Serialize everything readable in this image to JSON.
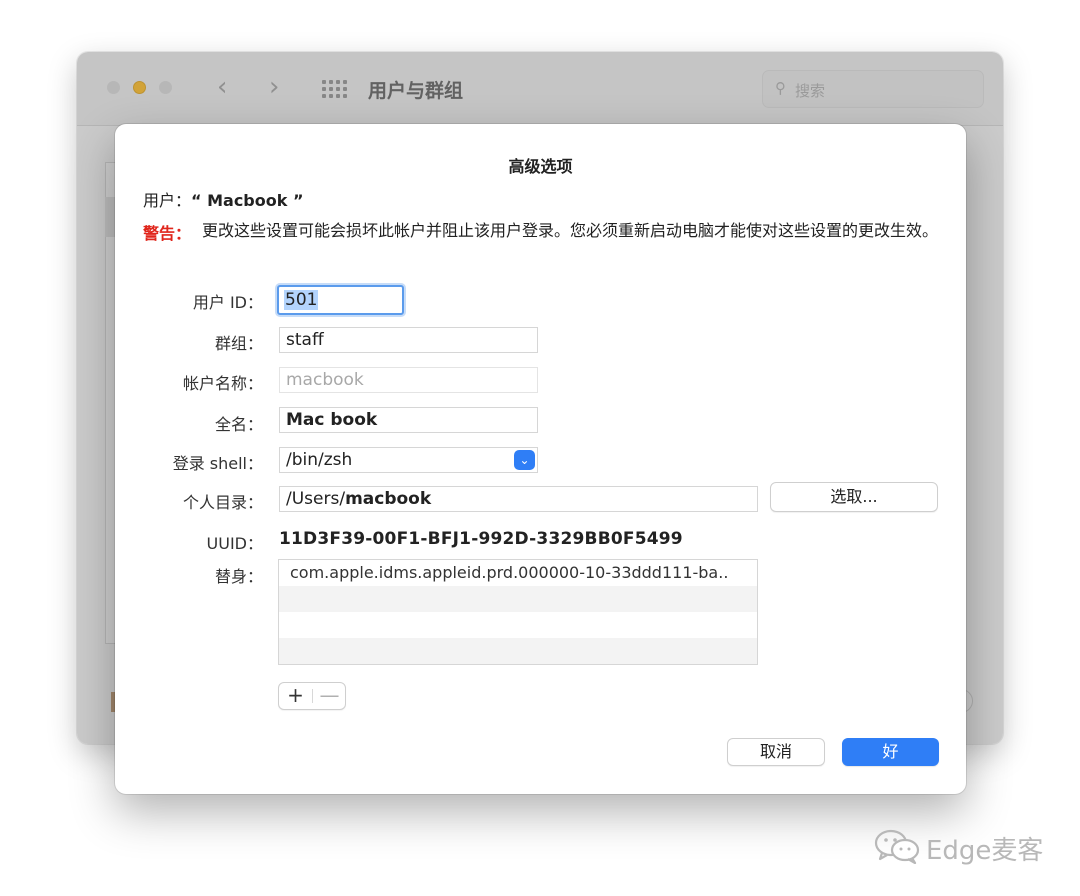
{
  "background_window": {
    "title": "用户与群组",
    "search_placeholder": "搜索"
  },
  "dialog": {
    "title": "高级选项",
    "user_label": "用户：",
    "user_name": "“ Macbook ”",
    "warning_label": "警告：",
    "warning_text": "更改这些设置可能会损坏此帐户并阻止该用户登录。您必须重新启动电脑才能使对这些设置的更改生效。",
    "fields": {
      "user_id_label": "用户 ID：",
      "user_id_value": "501",
      "group_label": "群组：",
      "group_value": "staff",
      "account_name_label": "帐户名称：",
      "account_name_value": "macbook",
      "full_name_label": "全名：",
      "full_name_value": "Mac book",
      "login_shell_label": "登录 shell：",
      "login_shell_value": "/bin/zsh",
      "home_dir_label": "个人目录：",
      "home_dir_prefix": "/Users/",
      "home_dir_name": "macbook",
      "choose_button": "选取...",
      "uuid_label": "UUID：",
      "uuid_value": "11D3F39-00F1-BFJ1-992D-3329BB0F5499",
      "aliases_label": "替身：",
      "aliases": [
        "com.apple.idms.appleid.prd.000000-10-33ddd111-ba.."
      ]
    },
    "add_symbol": "+",
    "remove_symbol": "—",
    "cancel_button": "取消",
    "ok_button": "好"
  },
  "watermark": {
    "text": "Edge麦客"
  },
  "colors": {
    "accent_blue": "#2f7ef6",
    "warning_red": "#e0261c",
    "minimize_yellow": "#f5b521"
  }
}
